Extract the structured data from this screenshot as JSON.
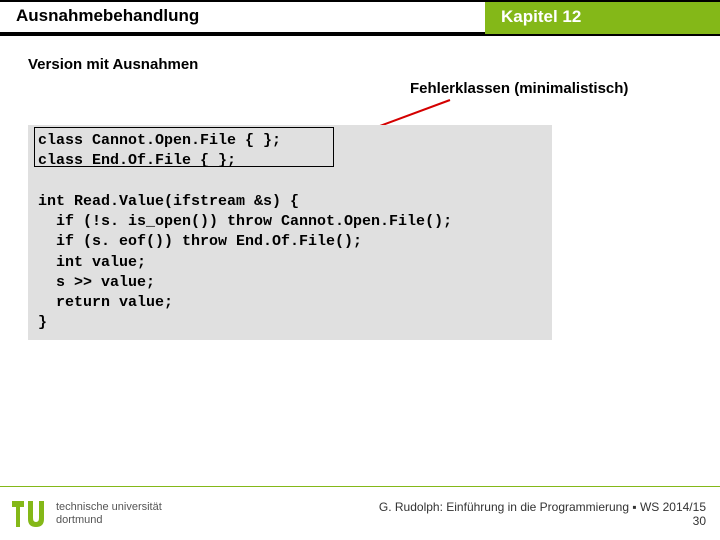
{
  "header": {
    "topic": "Ausnahmebehandlung",
    "chapter": "Kapitel 12"
  },
  "subtitle": "Version mit Ausnahmen",
  "caption": "Fehlerklassen (minimalistisch)",
  "code": "class Cannot.Open.File { };\nclass End.Of.File { };\n\nint Read.Value(ifstream &s) {\n  if (!s. is_open()) throw Cannot.Open.File();\n  if (s. eof()) throw End.Of.File();\n  int value;\n  s >> value;\n  return value;\n}",
  "footer": {
    "uni_line1": "technische universität",
    "uni_line2": "dortmund",
    "right_line1": "G. Rudolph: Einführung in die Programmierung ▪ WS 2014/15",
    "right_line2": "30"
  }
}
